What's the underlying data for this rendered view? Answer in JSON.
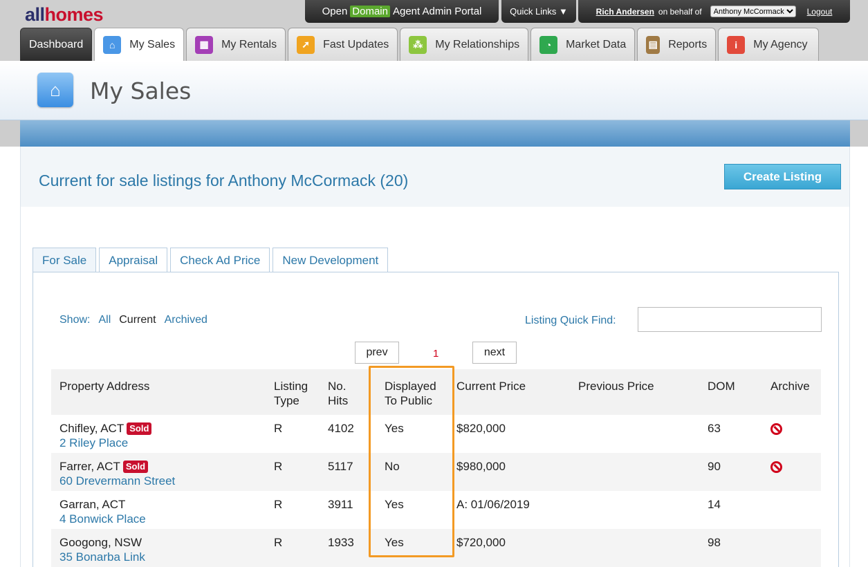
{
  "brand": {
    "logo_part1": "all",
    "logo_part2": "homes"
  },
  "portal": {
    "title_pre": "Open",
    "title_domain": "Domain",
    "title_post": "Agent Admin Portal",
    "quick_links": "Quick Links ▼",
    "user_name": "Rich Andersen",
    "behalf_text": "on behalf of",
    "behalf_selected": "Anthony McCormack",
    "logout": "Logout"
  },
  "nav": {
    "tabs": [
      {
        "label": "Dashboard"
      },
      {
        "label": "My Sales",
        "icon": "home-icon",
        "color": "#4a97e6"
      },
      {
        "label": "My Rentals",
        "icon": "building-icon",
        "color": "#a43fb6"
      },
      {
        "label": "Fast Updates",
        "icon": "lightning-icon",
        "color": "#f0a420"
      },
      {
        "label": "My Relationships",
        "icon": "people-icon",
        "color": "#8dc63f"
      },
      {
        "label": "Market Data",
        "icon": "pie-chart-icon",
        "color": "#2fa84f"
      },
      {
        "label": "Reports",
        "icon": "report-icon",
        "color": "#a07a45"
      },
      {
        "label": "My Agency",
        "icon": "person-icon",
        "color": "#e24a3b"
      }
    ]
  },
  "page": {
    "title": "My Sales"
  },
  "listings": {
    "heading": "Current for sale listings for Anthony McCormack (20)",
    "create_button": "Create Listing",
    "subtabs": [
      "For Sale",
      "Appraisal",
      "Check Ad Price",
      "New Development"
    ],
    "show_label": "Show:",
    "show_options": [
      "All",
      "Current",
      "Archived"
    ],
    "quick_find_label": "Listing Quick Find:",
    "quick_find_value": "",
    "pager": {
      "prev": "prev",
      "page": "1",
      "next": "next"
    },
    "columns": [
      "Property Address",
      "Listing Type",
      "No. Hits",
      "Displayed To Public",
      "Current Price",
      "Previous Price",
      "DOM",
      "Archive"
    ],
    "rows": [
      {
        "suburb": "Chifley, ACT",
        "sold": "Sold",
        "address": "2 Riley Place",
        "type": "R",
        "hits": "4102",
        "displayed": "Yes",
        "current_price": "$820,000",
        "previous_price": "",
        "dom": "63",
        "archive": true
      },
      {
        "suburb": "Farrer, ACT",
        "sold": "Sold",
        "address": "60 Drevermann Street",
        "type": "R",
        "hits": "5117",
        "displayed": "No",
        "current_price": "$980,000",
        "previous_price": "",
        "dom": "90",
        "archive": true
      },
      {
        "suburb": "Garran, ACT",
        "sold": "",
        "address": "4 Bonwick Place",
        "type": "R",
        "hits": "3911",
        "displayed": "Yes",
        "current_price": "A: 01/06/2019",
        "previous_price": "",
        "dom": "14",
        "archive": false
      },
      {
        "suburb": "Googong, NSW",
        "sold": "",
        "address": "35 Bonarba Link",
        "type": "R",
        "hits": "1933",
        "displayed": "Yes",
        "current_price": "$720,000",
        "previous_price": "",
        "dom": "98",
        "archive": false
      }
    ]
  },
  "colors": {
    "accent_blue": "#2c78a8",
    "sold_red": "#c8102e",
    "highlight_orange": "#f39a24"
  }
}
